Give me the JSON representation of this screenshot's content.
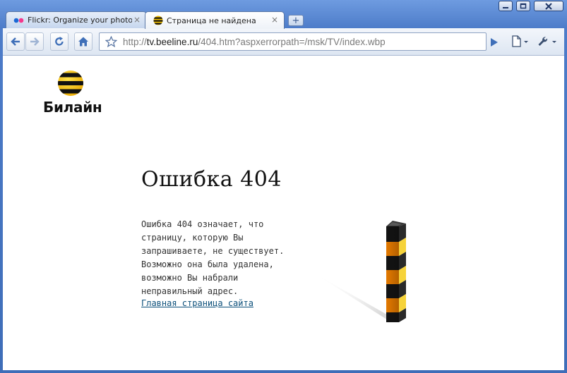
{
  "browser": {
    "tabs": [
      {
        "title": "Flickr: Organize your photo...",
        "active": false
      },
      {
        "title": "Страница не найдена",
        "active": true
      }
    ],
    "new_tab_symbol": "+",
    "close_symbol": "×",
    "address": {
      "scheme": "http://",
      "host": "tv.beeline.ru",
      "path": "/404.htm?aspxerrorpath=/msk/TV/index.wbp"
    }
  },
  "page": {
    "logo_text": "Билайн",
    "heading": "Ошибка 404",
    "message_lines": [
      "Ошибка 404 означает, что",
      "страницу, которую Вы",
      "запрашиваете, не существует.",
      "Возможно она была удалена,",
      "возможно Вы набрали",
      "неправильный адрес."
    ],
    "home_link": "Главная страница сайта"
  },
  "colors": {
    "brand_yellow": "#f6c400",
    "brand_black": "#111111",
    "link": "#0b4f7a",
    "post_orange": "#f08000"
  },
  "icons": [
    "back-icon",
    "forward-icon",
    "reload-icon",
    "home-icon",
    "star-icon",
    "go-icon",
    "page-menu-icon",
    "wrench-icon",
    "minimize-icon",
    "maximize-icon",
    "close-icon"
  ]
}
